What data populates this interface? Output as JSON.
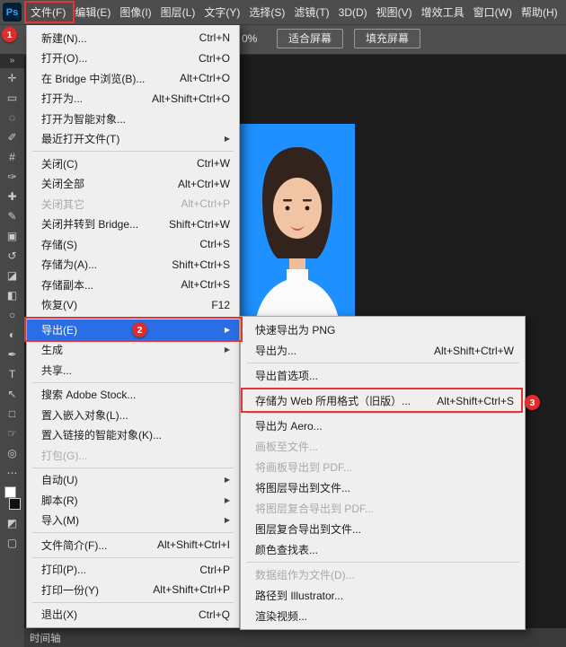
{
  "app": {
    "logo_text": "Ps"
  },
  "icons": {
    "submenu_arrow": "▶"
  },
  "menubar": {
    "items": [
      "文件(F)",
      "编辑(E)",
      "图像(I)",
      "图层(L)",
      "文字(Y)",
      "选择(S)",
      "滤镜(T)",
      "3D(D)",
      "视图(V)",
      "增效工具",
      "窗口(W)",
      "帮助(H)"
    ]
  },
  "options_bar": {
    "zoom_value": "0%",
    "fit_screen_label": "适合屏幕",
    "fill_screen_label": "填充屏幕"
  },
  "toolbar": {
    "expand_glyph": "»",
    "tools": [
      {
        "name": "move-tool",
        "glyph": "✛"
      },
      {
        "name": "marquee-tool",
        "glyph": "▭"
      },
      {
        "name": "lasso-tool",
        "glyph": "◌"
      },
      {
        "name": "quick-selection-tool",
        "glyph": "✐"
      },
      {
        "name": "crop-tool",
        "glyph": "#"
      },
      {
        "name": "eyedropper-tool",
        "glyph": "✑"
      },
      {
        "name": "healing-brush-tool",
        "glyph": "✚"
      },
      {
        "name": "brush-tool",
        "glyph": "✎"
      },
      {
        "name": "clone-stamp-tool",
        "glyph": "▣"
      },
      {
        "name": "history-brush-tool",
        "glyph": "↺"
      },
      {
        "name": "eraser-tool",
        "glyph": "◪"
      },
      {
        "name": "gradient-tool",
        "glyph": "◧"
      },
      {
        "name": "blur-tool",
        "glyph": "○"
      },
      {
        "name": "dodge-tool",
        "glyph": "◐"
      },
      {
        "name": "pen-tool",
        "glyph": "✒"
      },
      {
        "name": "type-tool",
        "glyph": "T"
      },
      {
        "name": "path-selection-tool",
        "glyph": "↖"
      },
      {
        "name": "shape-tool",
        "glyph": "□"
      },
      {
        "name": "hand-tool",
        "glyph": "☞"
      },
      {
        "name": "zoom-tool",
        "glyph": "◎"
      },
      {
        "name": "edit-toolbar-icon",
        "glyph": "⋯"
      }
    ],
    "bottom_tools": [
      {
        "name": "quick-mask-icon",
        "glyph": "◩"
      },
      {
        "name": "screen-mode-icon",
        "glyph": "▢"
      }
    ]
  },
  "file_menu": {
    "items": [
      {
        "label": "新建(N)...",
        "shortcut": "Ctrl+N"
      },
      {
        "label": "打开(O)...",
        "shortcut": "Ctrl+O"
      },
      {
        "label": "在 Bridge 中浏览(B)...",
        "shortcut": "Alt+Ctrl+O"
      },
      {
        "label": "打开为...",
        "shortcut": "Alt+Shift+Ctrl+O"
      },
      {
        "label": "打开为智能对象..."
      },
      {
        "label": "最近打开文件(T)",
        "submenu": true
      },
      {
        "separator": true
      },
      {
        "label": "关闭(C)",
        "shortcut": "Ctrl+W"
      },
      {
        "label": "关闭全部",
        "shortcut": "Alt+Ctrl+W"
      },
      {
        "label": "关闭其它",
        "shortcut": "Alt+Ctrl+P",
        "disabled": true
      },
      {
        "label": "关闭并转到 Bridge...",
        "shortcut": "Shift+Ctrl+W"
      },
      {
        "label": "存储(S)",
        "shortcut": "Ctrl+S"
      },
      {
        "label": "存储为(A)...",
        "shortcut": "Shift+Ctrl+S"
      },
      {
        "label": "存储副本...",
        "shortcut": "Alt+Ctrl+S"
      },
      {
        "label": "恢复(V)",
        "shortcut": "F12"
      },
      {
        "separator": true
      },
      {
        "label": "导出(E)",
        "submenu": true,
        "highlighted": true
      },
      {
        "label": "生成",
        "submenu": true
      },
      {
        "label": "共享..."
      },
      {
        "separator": true
      },
      {
        "label": "搜索 Adobe Stock..."
      },
      {
        "label": "置入嵌入对象(L)..."
      },
      {
        "label": "置入链接的智能对象(K)..."
      },
      {
        "label": "打包(G)...",
        "disabled": true
      },
      {
        "separator": true
      },
      {
        "label": "自动(U)",
        "submenu": true
      },
      {
        "label": "脚本(R)",
        "submenu": true
      },
      {
        "label": "导入(M)",
        "submenu": true
      },
      {
        "separator": true
      },
      {
        "label": "文件简介(F)...",
        "shortcut": "Alt+Shift+Ctrl+I"
      },
      {
        "separator": true
      },
      {
        "label": "打印(P)...",
        "shortcut": "Ctrl+P"
      },
      {
        "label": "打印一份(Y)",
        "shortcut": "Alt+Shift+Ctrl+P"
      },
      {
        "separator": true
      },
      {
        "label": "退出(X)",
        "shortcut": "Ctrl+Q"
      }
    ]
  },
  "export_menu": {
    "items": [
      {
        "label": "快速导出为 PNG"
      },
      {
        "label": "导出为...",
        "shortcut": "Alt+Shift+Ctrl+W"
      },
      {
        "separator": true
      },
      {
        "label": "导出首选项..."
      },
      {
        "separator": true
      },
      {
        "label": "存储为 Web 所用格式（旧版）...",
        "shortcut": "Alt+Shift+Ctrl+S"
      },
      {
        "separator": true
      },
      {
        "label": "导出为 Aero..."
      },
      {
        "label": "画板至文件...",
        "disabled": true
      },
      {
        "label": "将画板导出到 PDF...",
        "disabled": true
      },
      {
        "label": "将图层导出到文件..."
      },
      {
        "label": "将图层复合导出到 PDF...",
        "disabled": true
      },
      {
        "label": "图层复合导出到文件..."
      },
      {
        "label": "颜色查找表..."
      },
      {
        "separator": true
      },
      {
        "label": "数据组作为文件(D)...",
        "disabled": true
      },
      {
        "label": "路径到 Illustrator..."
      },
      {
        "label": "渲染视频..."
      }
    ]
  },
  "annotations": {
    "steps": [
      "1",
      "2",
      "3"
    ]
  },
  "timeline": {
    "label": "时间轴"
  },
  "colors": {
    "menu_highlight": "#2a6ee5",
    "annotation_red": "#e43434",
    "photo_background": "#1e90ff"
  }
}
